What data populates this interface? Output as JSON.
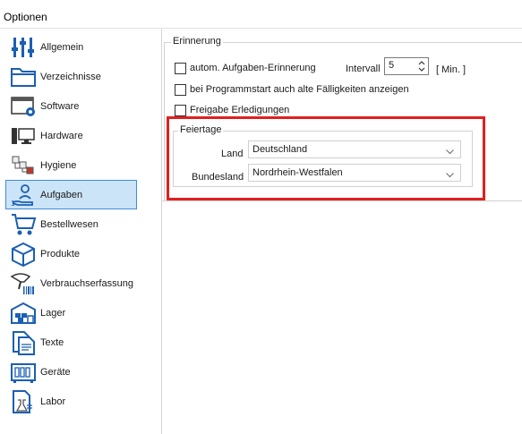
{
  "window": {
    "title": "Optionen"
  },
  "sidebar": {
    "items": [
      {
        "label": "Allgemein",
        "icon": "sliders-icon",
        "active": false
      },
      {
        "label": "Verzeichnisse",
        "icon": "folder-icon",
        "active": false
      },
      {
        "label": "Software",
        "icon": "software-window-icon",
        "active": false
      },
      {
        "label": "Hardware",
        "icon": "computer-icon",
        "active": false
      },
      {
        "label": "Hygiene",
        "icon": "hygiene-icon",
        "active": false
      },
      {
        "label": "Aufgaben",
        "icon": "hand-person-icon",
        "active": true
      },
      {
        "label": "Bestellwesen",
        "icon": "cart-icon",
        "active": false
      },
      {
        "label": "Produkte",
        "icon": "box-icon",
        "active": false
      },
      {
        "label": "Verbrauchserfassung",
        "icon": "barcode-scanner-icon",
        "active": false
      },
      {
        "label": "Lager",
        "icon": "warehouse-icon",
        "active": false
      },
      {
        "label": "Texte",
        "icon": "documents-icon",
        "active": false
      },
      {
        "label": "Geräte",
        "icon": "device-icon",
        "active": false
      },
      {
        "label": "Labor",
        "icon": "lab-icon",
        "active": false
      }
    ]
  },
  "erinnerung": {
    "title": "Erinnerung",
    "auto_reminder_label": "autom. Aufgaben-Erinnerung",
    "auto_reminder_checked": false,
    "interval_label": "Intervall",
    "interval_value": "5",
    "interval_unit": "[ Min. ]",
    "show_overdue_label": "bei Programmstart auch alte Fälligkeiten anzeigen",
    "show_overdue_checked": false,
    "release_label": "Freigabe Erledigungen",
    "release_checked": false
  },
  "feiertage": {
    "title": "Feiertage",
    "land_label": "Land",
    "land_value": "Deutschland",
    "bundesland_label": "Bundesland",
    "bundesland_value": "Nordrhein-Westfalen"
  },
  "colors": {
    "highlight": "#e0201f",
    "active_bg": "#cce4f7",
    "active_border": "#3d8ed8",
    "icon_blue": "#1b5fb1"
  }
}
